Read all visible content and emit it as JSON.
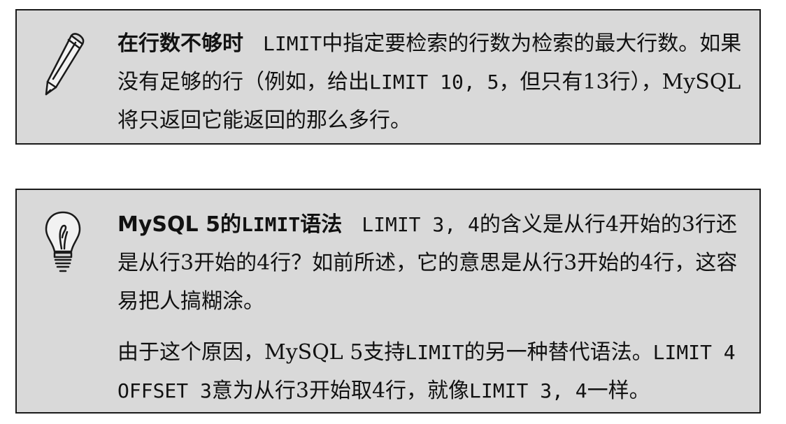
{
  "note1": {
    "icon": "pencil-icon",
    "title": "在行数不够时",
    "code1": "LIMIT",
    "t1": "中指定要检索的行数为检索的最大行数。如果没有足够的行（例如，给出",
    "code2": "LIMIT 10, 5",
    "t2": "，但只有13行），MySQL将只返回它能返回的那么多行。"
  },
  "note2": {
    "icon": "lightbulb-icon",
    "title_a": "MySQL 5的",
    "title_code": "LIMIT",
    "title_b": "语法",
    "p1_code1": "LIMIT 3, 4",
    "p1_t1": "的含义是从行4开始的3行还是从行3开始的4行？如前所述，它的意思是从行3开始的4行，这容易把人搞糊涂。",
    "p2_t1": "由于这个原因，MySQL 5支持",
    "p2_code1": "LIMIT",
    "p2_t2": "的另一种替代语法。",
    "p2_code2": "LIMIT 4 OFFSET 3",
    "p2_t3": "意为从行3开始取4行，就像",
    "p2_code3": "LIMIT 3, 4",
    "p2_t4": "一样。"
  }
}
